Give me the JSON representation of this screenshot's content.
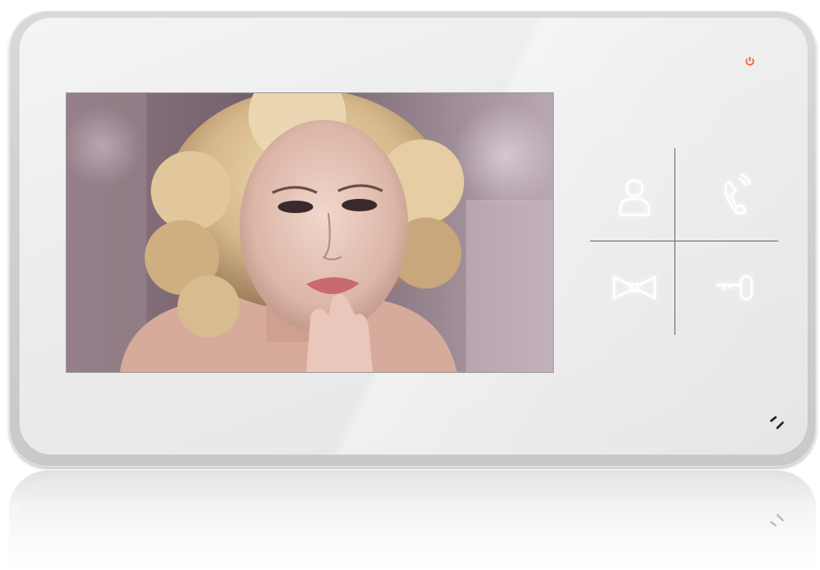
{
  "device": {
    "name": "video-intercom-monitor",
    "body_color": "#e9e9e9"
  },
  "screen": {
    "content": "video-feed-portrait"
  },
  "indicators": {
    "power_icon": "power-icon",
    "power_color": "#ff5a2a"
  },
  "keys": [
    {
      "icon": "user-icon"
    },
    {
      "icon": "handset-icon"
    },
    {
      "icon": "bell-icon"
    },
    {
      "icon": "key-icon"
    }
  ],
  "microphone": {
    "icon": "microphone-grille-icon"
  }
}
